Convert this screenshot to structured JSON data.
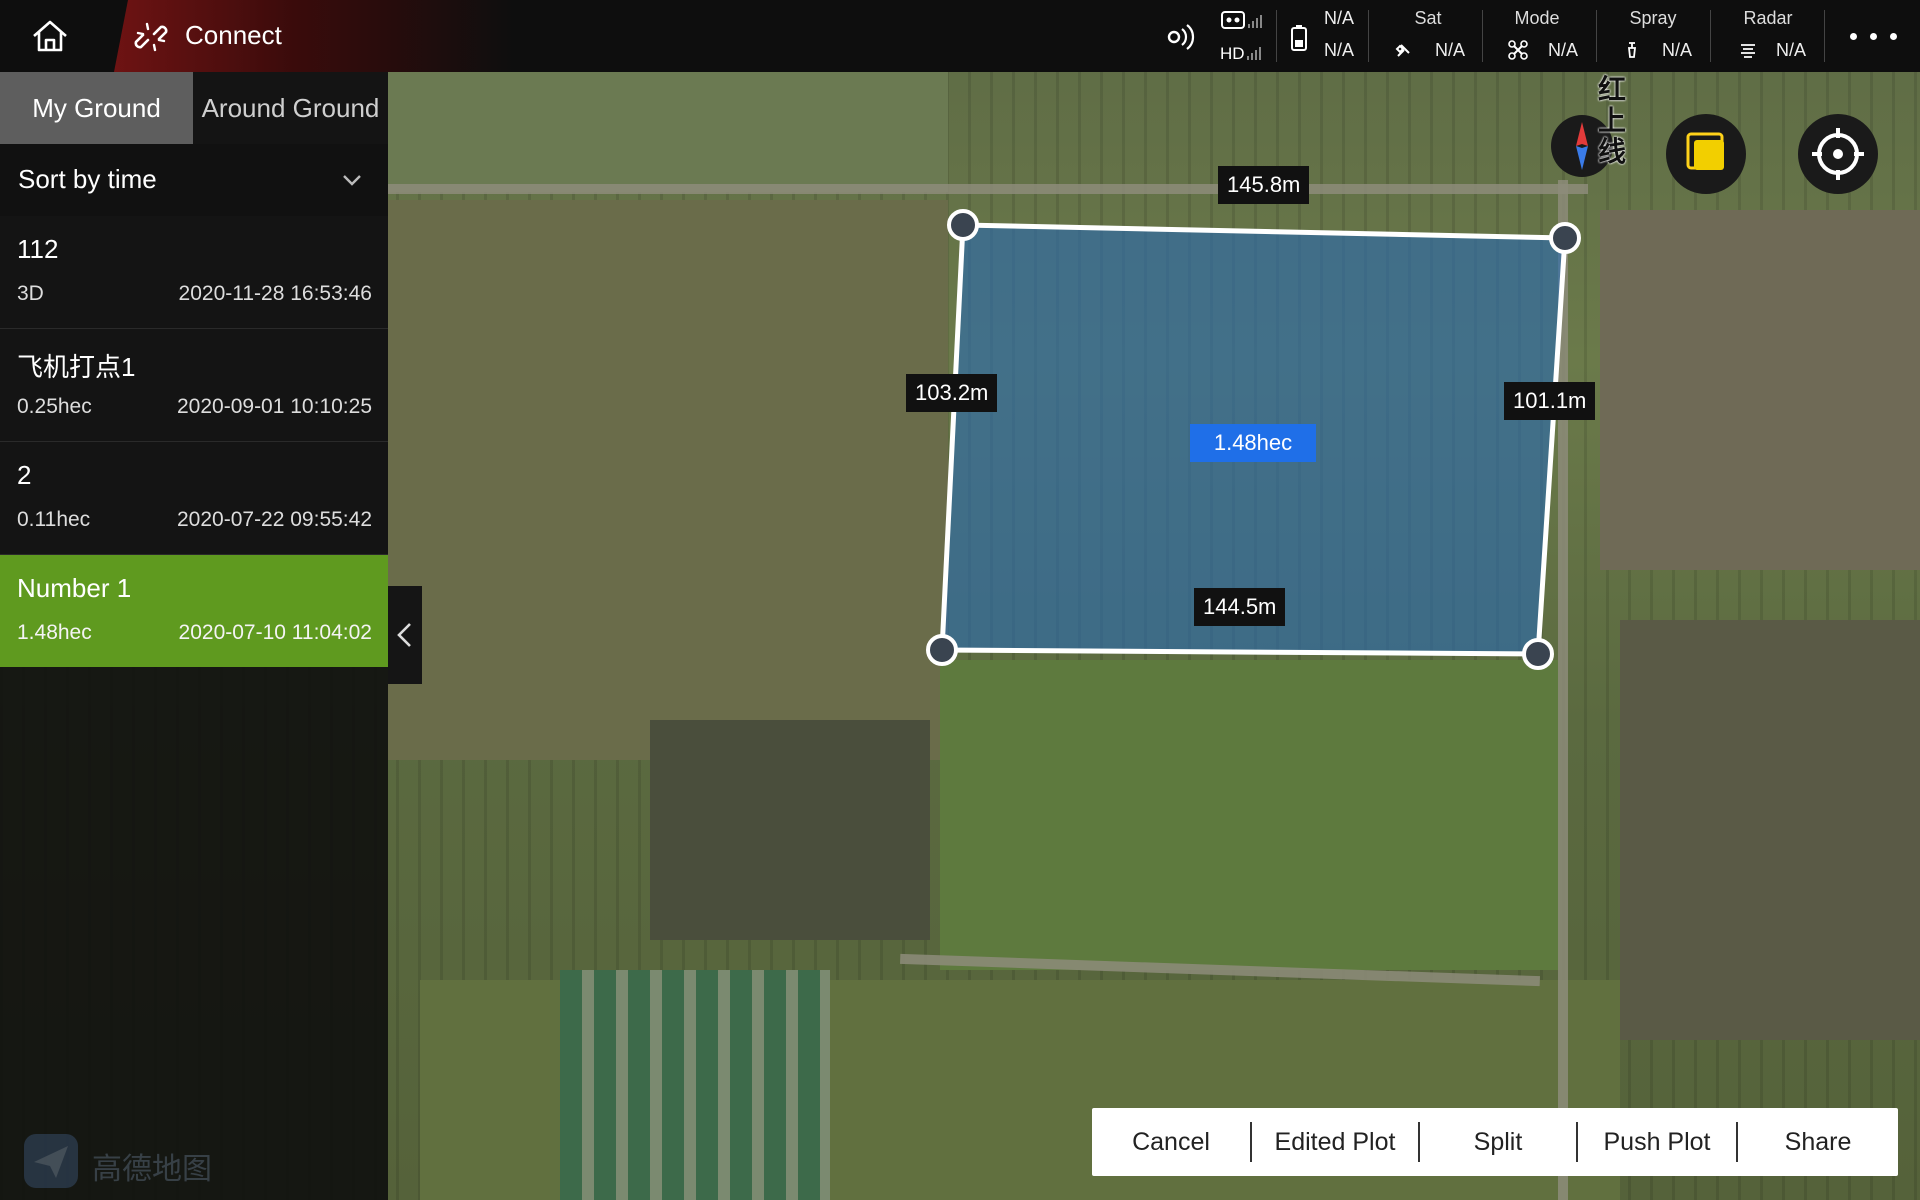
{
  "topbar": {
    "connect_label": "Connect",
    "hd_label": "HD",
    "signal_top": "N/A",
    "signal_bottom": "N/A",
    "status": [
      {
        "title": "Sat",
        "value": "N/A",
        "icon": "satellite-icon"
      },
      {
        "title": "Mode",
        "value": "N/A",
        "icon": "drone-icon"
      },
      {
        "title": "Spray",
        "value": "N/A",
        "icon": "spray-icon"
      },
      {
        "title": "Radar",
        "value": "N/A",
        "icon": "radar-icon"
      }
    ]
  },
  "sidebar": {
    "tabs": {
      "my": "My Ground",
      "around": "Around Ground"
    },
    "sort_label": "Sort by time",
    "items": [
      {
        "name": "112",
        "area": "3D",
        "date": "2020-11-28 16:53:46",
        "selected": false
      },
      {
        "name": "飞机打点1",
        "area": "0.25hec",
        "date": "2020-09-01 10:10:25",
        "selected": false
      },
      {
        "name": "2",
        "area": "0.11hec",
        "date": "2020-07-22 09:55:42",
        "selected": false
      },
      {
        "name": "Number 1",
        "area": "1.48hec",
        "date": "2020-07-10 11:04:02",
        "selected": true
      }
    ],
    "watermark": "高德地图"
  },
  "map": {
    "compass_text": "红上线",
    "plot": {
      "area_label": "1.48hec",
      "top_length": "145.8m",
      "left_length": "103.2m",
      "right_length": "101.1m",
      "bottom_length": "144.5m"
    }
  },
  "actions": {
    "cancel": "Cancel",
    "edited_plot": "Edited Plot",
    "split": "Split",
    "push_plot": "Push Plot",
    "share": "Share"
  },
  "colors": {
    "selected_item": "#5f9a1f",
    "area_badge": "#1f6fe8",
    "plot_fill": "#2a6ab0"
  }
}
